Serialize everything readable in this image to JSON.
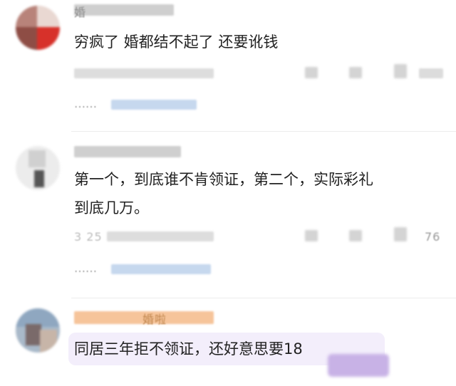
{
  "comments": [
    {
      "username": "婚",
      "text": "穷疯了 婚都结不起了 还要讹钱",
      "reply_label": "……"
    },
    {
      "username": "",
      "text_lines": [
        "第一个，到底谁不肯领证，第二个，实际彩礼",
        "到底几万。"
      ],
      "time": "3 25",
      "like_count": "76",
      "reply_label": "……"
    },
    {
      "username": "婚啦",
      "text": "同居三年拒不领证，还好意思要18"
    }
  ],
  "colors": {
    "text": "#222222",
    "username_blur": "#c9c9c9",
    "highlight_username": "#f6c49a",
    "reply_link": "#c6d8ee",
    "bubble_bg": "#f3eefb",
    "sticker": "#c8b2e6"
  },
  "icons": [
    "share-icon",
    "comment-icon",
    "like-icon"
  ]
}
